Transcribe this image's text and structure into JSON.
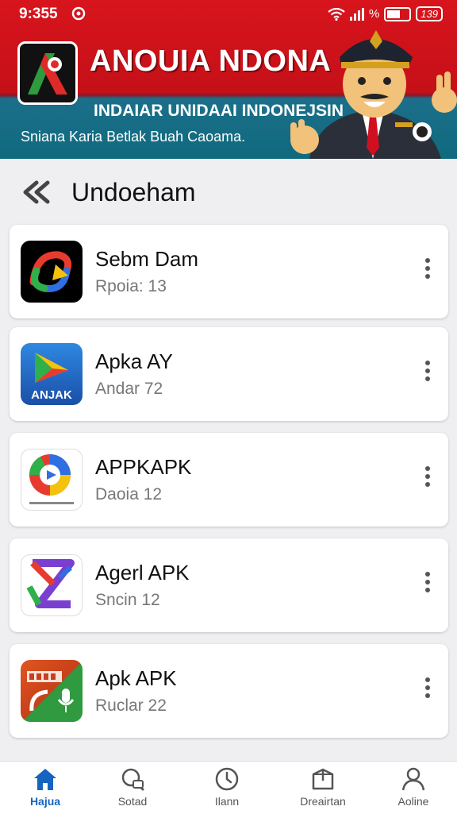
{
  "status_bar": {
    "time": "9:355",
    "signal_text": "%",
    "battery_text": "139"
  },
  "banner": {
    "title": "ANOUIA NDONA",
    "subtitle": "INDAIAR UNIDAAI INDONEJSIN",
    "tagline": "Sniana Karia Betlak Buah Caoama."
  },
  "page": {
    "title": "Undoeham"
  },
  "apps": [
    {
      "name": "Sebm Dam",
      "meta": "Rpoia: 13"
    },
    {
      "name": "Apka AY",
      "meta": "Andar 72",
      "icon_text": "ANJAK"
    },
    {
      "name": "APPKAPK",
      "meta": "Daoia 12"
    },
    {
      "name": "Agerl APK",
      "meta": "Sncin 12"
    },
    {
      "name": "Apk APK",
      "meta": "Ruclar 22"
    }
  ],
  "nav": {
    "items": [
      {
        "label": "Hajua",
        "icon": "home-icon"
      },
      {
        "label": "Sotad",
        "icon": "search-icon"
      },
      {
        "label": "Ilann",
        "icon": "clock-icon"
      },
      {
        "label": "Dreairtan",
        "icon": "box-icon"
      },
      {
        "label": "Aoline",
        "icon": "user-icon"
      }
    ]
  },
  "colors": {
    "banner_red": "#d8141c",
    "banner_teal": "#0f6a7d",
    "active_nav": "#1565c0"
  }
}
